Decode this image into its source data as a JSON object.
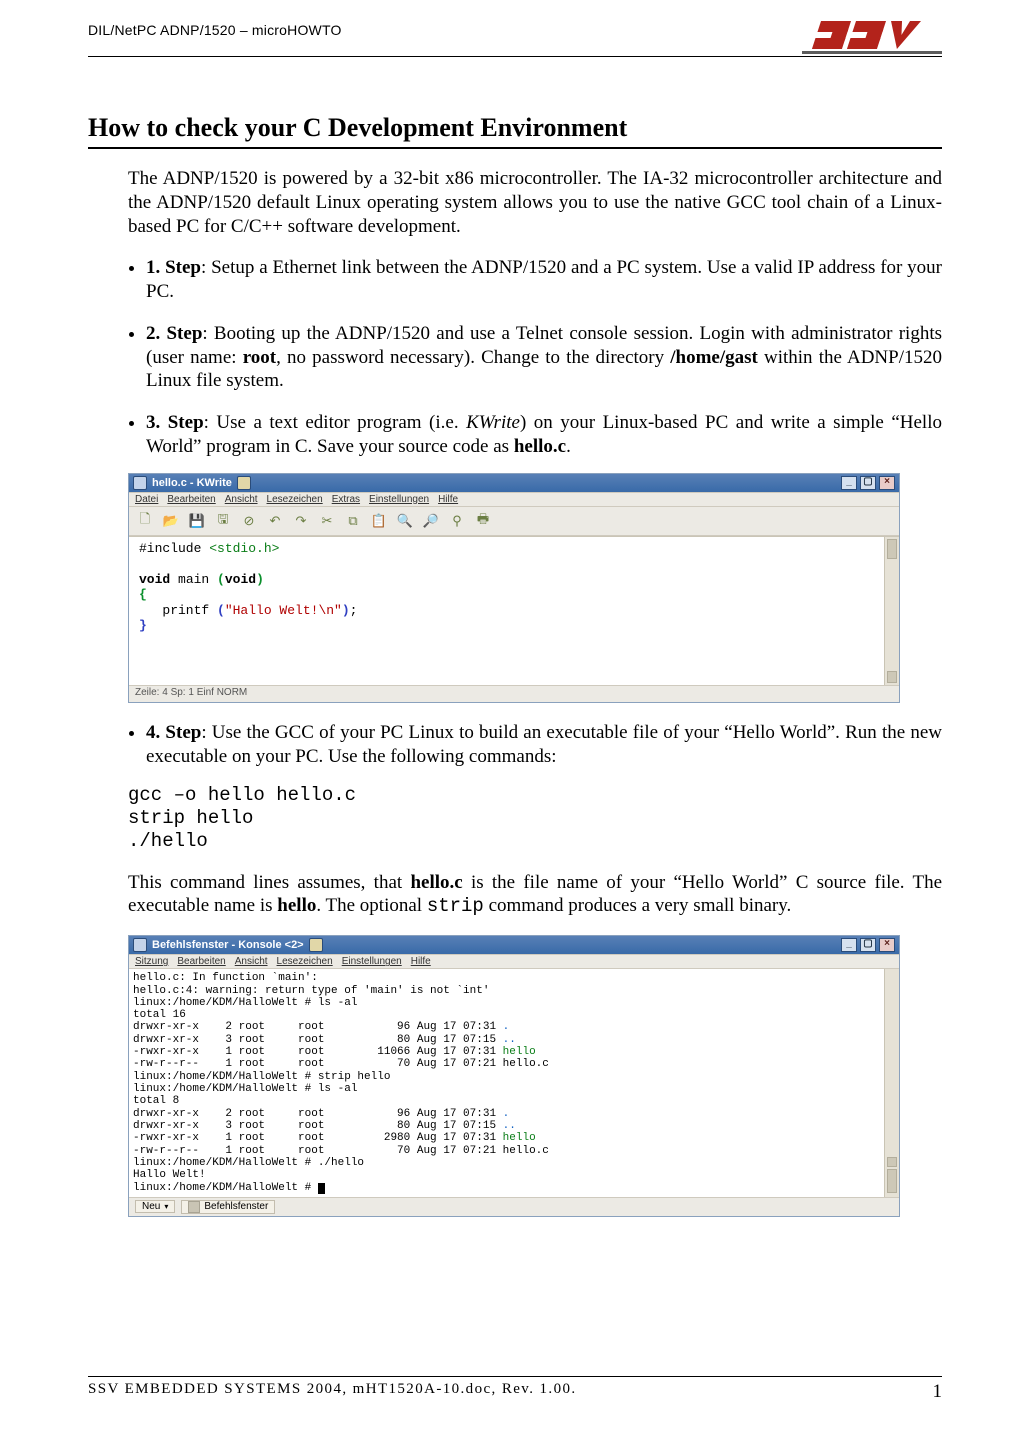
{
  "header": {
    "doc_id": "DIL/NetPC ADNP/1520 – microHOWTO",
    "brand": "SSV"
  },
  "title": "How to check your C Development Environment",
  "intro": "The ADNP/1520 is powered by a 32-bit x86 microcontroller. The IA-32 microcontroller architecture and the ADNP/1520 default Linux operating system allows you to use the native GCC tool chain of a Linux-based PC for C/C++ software development.",
  "steps": {
    "s1": {
      "label": "1. Step",
      "text": ": Setup a Ethernet link between the ADNP/1520 and a PC system. Use a valid IP address for your PC."
    },
    "s2": {
      "label": "2. Step",
      "pre": ": Booting up the ADNP/1520 and use a Telnet console session. Login with administrator rights (user name: ",
      "root": "root",
      "mid": ", no password necessary). Change to the directory ",
      "dir": "/home/gast",
      "post": " within the ADNP/1520 Linux file system."
    },
    "s3": {
      "label": "3. Step",
      "pre": ": Use a text editor program (i.e. ",
      "app": "KWrite",
      "mid": ") on your Linux-based PC and write a simple “Hello World” program in C. Save your source code as ",
      "file": "hello.c",
      "post": "."
    },
    "s4": {
      "label": "4. Step",
      "text": ": Use the GCC of your PC Linux to build an executable file of your “Hello World”. Run the new executable on your PC. Use the following commands:"
    }
  },
  "kwrite": {
    "title": "hello.c - KWrite",
    "menu": [
      "Datei",
      "Bearbeiten",
      "Ansicht",
      "Lesezeichen",
      "Extras",
      "Einstellungen",
      "Hilfe"
    ],
    "code": {
      "l1a": "#include ",
      "l1b": "<stdio.h>",
      "l2": "",
      "l3a": "void ",
      "l3b": "main ",
      "l3c": "(",
      "l3d": "void",
      "l3e": ")",
      "l4": "{",
      "l5a": "   printf ",
      "l5b": "(",
      "l5c": "\"Hallo Welt!\\n\"",
      "l5d": ")",
      "l5e": ";",
      "l6": "}"
    },
    "status": "Zeile: 4 Sp: 1  Einf  NORM"
  },
  "shell": "gcc –o hello hello.c\nstrip hello\n./hello",
  "after": {
    "pre": "This command lines assumes, that ",
    "file": "hello.c",
    "mid": " is the file name of your “Hello World” C source file. The executable name is ",
    "exe": "hello",
    "mid2": ". The optional ",
    "cmd": "strip",
    "post": " command produces a very small binary."
  },
  "konsole": {
    "title": "Befehlsfenster - Konsole <2>",
    "menu": [
      "Sitzung",
      "Bearbeiten",
      "Ansicht",
      "Lesezeichen",
      "Einstellungen",
      "Hilfe"
    ],
    "lines": {
      "l01": "hello.c: In function `main':",
      "l02": "hello.c:4: warning: return type of 'main' is not `int'",
      "l03": "linux:/home/KDM/HalloWelt # ls -al",
      "l04": "total 16",
      "l05a": "drwxr-xr-x    2 root     root           96 Aug 17 07:31 ",
      "l05b": ".",
      "l06a": "drwxr-xr-x    3 root     root           80 Aug 17 07:15 ",
      "l06b": "..",
      "l07a": "-rwxr-xr-x    1 root     root        11066 Aug 17 07:31 ",
      "l07b": "hello",
      "l08": "-rw-r--r--    1 root     root           70 Aug 17 07:21 hello.c",
      "l09": "linux:/home/KDM/HalloWelt # strip hello",
      "l10": "linux:/home/KDM/HalloWelt # ls -al",
      "l11": "total 8",
      "l12a": "drwxr-xr-x    2 root     root           96 Aug 17 07:31 ",
      "l12b": ".",
      "l13a": "drwxr-xr-x    3 root     root           80 Aug 17 07:15 ",
      "l13b": "..",
      "l14a": "-rwxr-xr-x    1 root     root         2980 Aug 17 07:31 ",
      "l14b": "hello",
      "l15": "-rw-r--r--    1 root     root           70 Aug 17 07:21 hello.c",
      "l16": "linux:/home/KDM/HalloWelt # ./hello",
      "l17": "Hallo Welt!",
      "l18": "linux:/home/KDM/HalloWelt # "
    },
    "tab_new": "Neu",
    "tab_label": "Befehlsfenster"
  },
  "footer": {
    "left": "SSV EMBEDDED SYSTEMS 2004, mHT1520A-10.doc, Rev. 1.00.",
    "page": "1"
  }
}
